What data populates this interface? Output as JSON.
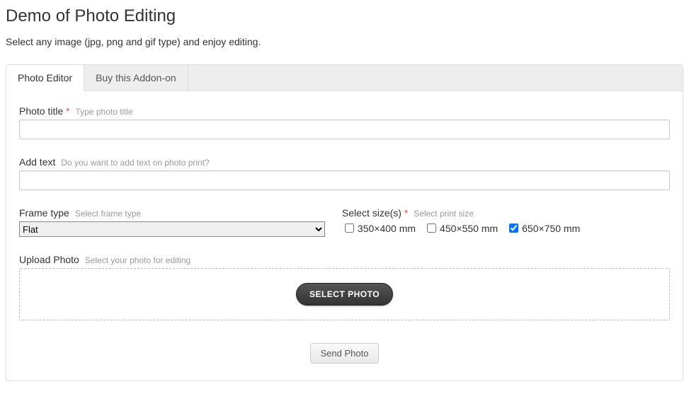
{
  "page": {
    "title": "Demo of Photo Editing",
    "intro": "Select any image (jpg, png and gif type) and enjoy editing."
  },
  "tabs": {
    "editor": "Photo Editor",
    "buy": "Buy this Addon-on"
  },
  "fields": {
    "photo_title": {
      "label": "Photo title",
      "hint": "Type photo title",
      "value": ""
    },
    "add_text": {
      "label": "Add text",
      "hint": "Do you want to add text on photo print?",
      "value": ""
    },
    "frame_type": {
      "label": "Frame type",
      "hint": "Select frame type",
      "selected": "Flat"
    },
    "sizes": {
      "label": "Select size(s)",
      "hint": "Select print size",
      "options": [
        {
          "label": "350×400 mm",
          "checked": false
        },
        {
          "label": "450×550 mm",
          "checked": false
        },
        {
          "label": "650×750 mm",
          "checked": true
        }
      ]
    },
    "upload": {
      "label": "Upload Photo",
      "hint": "Select your photo for editing",
      "button": "SELECT PHOTO"
    }
  },
  "submit": {
    "label": "Send Photo"
  }
}
